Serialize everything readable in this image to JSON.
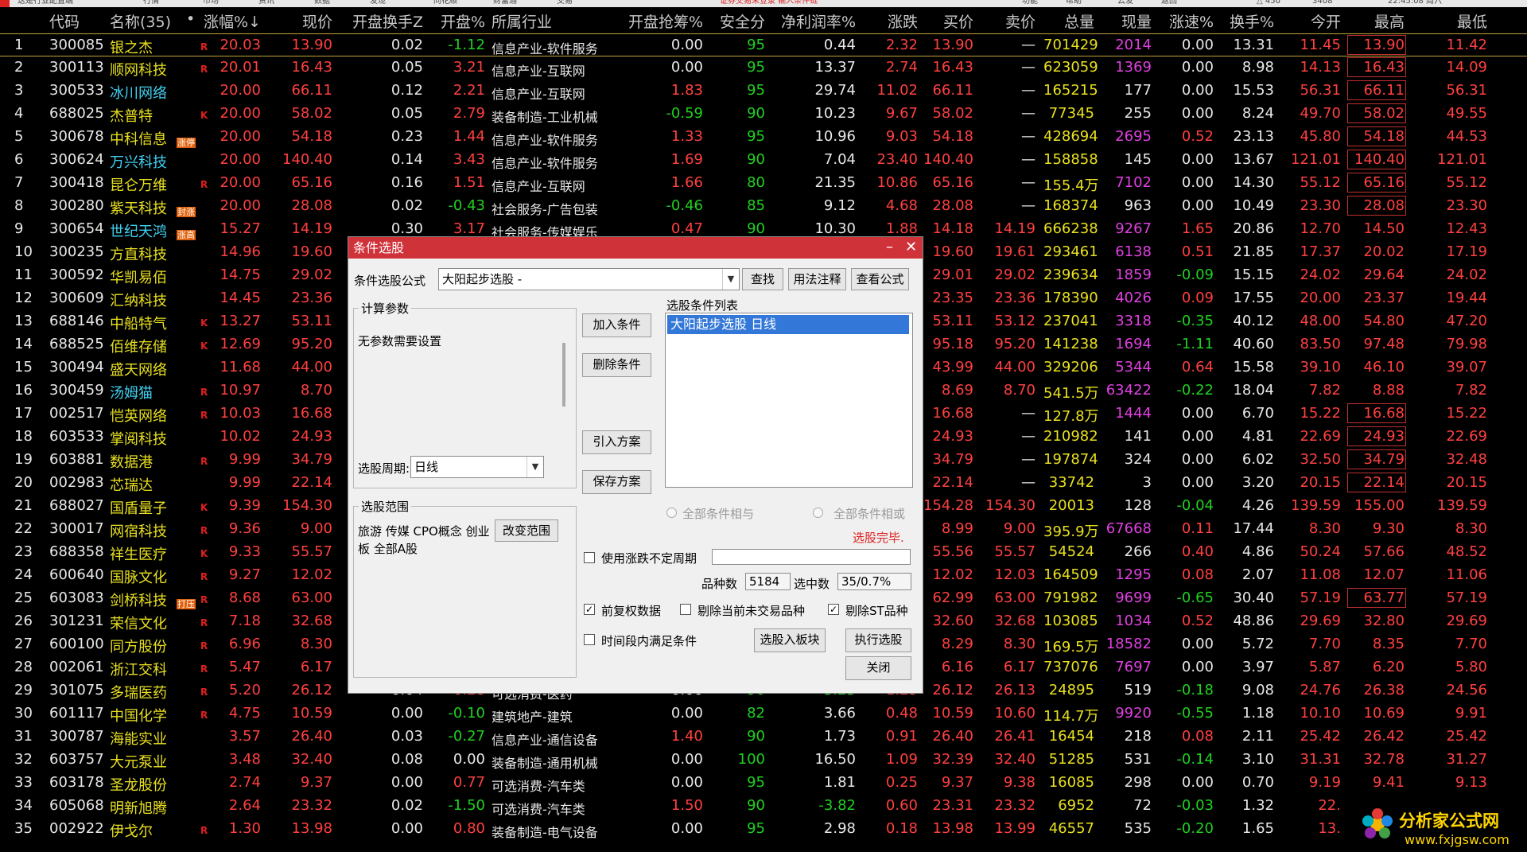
{
  "topbar": {
    "items": [
      "这是行业配置端",
      "行情",
      "市场",
      "资讯",
      "数据",
      "发现",
      "同花顺",
      "财富通",
      "交易",
      "证券交易未登录 输入条件链",
      "功能",
      "帮助",
      "云发",
      "返回",
      "△ 450",
      "3408",
      "22:45:08 周六"
    ]
  },
  "header": {
    "cols": [
      "代码",
      "名称(35)",
      "•",
      "涨幅%↓",
      "现价",
      "开盘换手Z",
      "开盘%",
      "所属行业",
      "开盘抢筹%",
      "安全分",
      "净利润率%",
      "涨跌",
      "买价",
      "卖价",
      "总量",
      "现量",
      "涨速%",
      "换手%",
      "今开",
      "最高",
      "最低"
    ]
  },
  "colors": {
    "red": "#ff4040",
    "green": "#20d020",
    "yellow": "#e8e020",
    "cyan": "#40d0f0",
    "white": "#e8e8e8",
    "magenta": "#e040e0",
    "dialog_title": "#d0323a",
    "selection": "#3378d8"
  },
  "rows": [
    {
      "no": "1",
      "code": "300085",
      "name": "银之杰",
      "tag": "",
      "flag": "R",
      "chg": "20.03",
      "price": "13.90",
      "oturn": "0.02",
      "opct": "-1.12",
      "industry": "信息产业-软件服务",
      "grab": "0.00",
      "safe": "95",
      "npm": "0.44",
      "diff": "2.32",
      "bid": "13.90",
      "ask": "—",
      "vol": "701429",
      "cur": "2014",
      "speed": "0.00",
      "turn": "13.31",
      "open": "11.45",
      "high": "13.90",
      "low": "11.42",
      "nameColor": "yellow"
    },
    {
      "no": "2",
      "code": "300113",
      "name": "顺网科技",
      "tag": "",
      "flag": "R",
      "chg": "20.01",
      "price": "16.43",
      "oturn": "0.05",
      "opct": "3.21",
      "industry": "信息产业-互联网",
      "grab": "0.00",
      "safe": "95",
      "npm": "13.37",
      "diff": "2.74",
      "bid": "16.43",
      "ask": "—",
      "vol": "623059",
      "cur": "1369",
      "speed": "0.00",
      "turn": "8.98",
      "open": "14.13",
      "high": "16.43",
      "low": "14.09",
      "nameColor": "yellow"
    },
    {
      "no": "3",
      "code": "300533",
      "name": "冰川网络",
      "tag": "",
      "flag": "",
      "chg": "20.00",
      "price": "66.11",
      "oturn": "0.12",
      "opct": "2.21",
      "industry": "信息产业-互联网",
      "grab": "1.83",
      "safe": "95",
      "npm": "29.74",
      "diff": "11.02",
      "bid": "66.11",
      "ask": "—",
      "vol": "165215",
      "cur": "177",
      "speed": "0.00",
      "turn": "15.53",
      "open": "56.31",
      "high": "66.11",
      "low": "56.31",
      "nameColor": "cyan"
    },
    {
      "no": "4",
      "code": "688025",
      "name": "杰普特",
      "tag": "",
      "flag": "K",
      "chg": "20.00",
      "price": "58.02",
      "oturn": "0.05",
      "opct": "2.79",
      "industry": "装备制造-工业机械",
      "grab": "-0.59",
      "safe": "90",
      "npm": "10.23",
      "diff": "9.67",
      "bid": "58.02",
      "ask": "—",
      "vol": "77345",
      "cur": "255",
      "speed": "0.00",
      "turn": "8.24",
      "open": "49.70",
      "high": "58.02",
      "low": "49.55",
      "nameColor": "yellow"
    },
    {
      "no": "5",
      "code": "300678",
      "name": "中科信息",
      "tag": "涨停",
      "flag": "",
      "chg": "20.00",
      "price": "54.18",
      "oturn": "0.23",
      "opct": "1.44",
      "industry": "信息产业-软件服务",
      "grab": "1.33",
      "safe": "95",
      "npm": "10.96",
      "diff": "9.03",
      "bid": "54.18",
      "ask": "—",
      "vol": "428694",
      "cur": "2695",
      "speed": "0.52",
      "turn": "23.13",
      "open": "45.80",
      "high": "54.18",
      "low": "44.53",
      "nameColor": "yellow"
    },
    {
      "no": "6",
      "code": "300624",
      "name": "万兴科技",
      "tag": "",
      "flag": "",
      "chg": "20.00",
      "price": "140.40",
      "oturn": "0.14",
      "opct": "3.43",
      "industry": "信息产业-软件服务",
      "grab": "1.69",
      "safe": "90",
      "npm": "7.04",
      "diff": "23.40",
      "bid": "140.40",
      "ask": "—",
      "vol": "158858",
      "cur": "145",
      "speed": "0.00",
      "turn": "13.67",
      "open": "121.01",
      "high": "140.40",
      "low": "121.01",
      "nameColor": "cyan"
    },
    {
      "no": "7",
      "code": "300418",
      "name": "昆仑万维",
      "tag": "",
      "flag": "R",
      "chg": "20.00",
      "price": "65.16",
      "oturn": "0.16",
      "opct": "1.51",
      "industry": "信息产业-互联网",
      "grab": "1.66",
      "safe": "80",
      "npm": "21.35",
      "diff": "10.86",
      "bid": "65.16",
      "ask": "—",
      "vol": "155.4万",
      "cur": "7102",
      "speed": "0.00",
      "turn": "14.30",
      "open": "55.12",
      "high": "65.16",
      "low": "55.12",
      "nameColor": "yellow"
    },
    {
      "no": "8",
      "code": "300280",
      "name": "紫天科技",
      "tag": "封涨",
      "flag": "",
      "chg": "20.00",
      "price": "28.08",
      "oturn": "0.02",
      "opct": "-0.43",
      "industry": "社会服务-广告包装",
      "grab": "-0.46",
      "safe": "85",
      "npm": "9.12",
      "diff": "4.68",
      "bid": "28.08",
      "ask": "—",
      "vol": "168374",
      "cur": "963",
      "speed": "0.00",
      "turn": "10.49",
      "open": "23.30",
      "high": "28.08",
      "low": "23.30",
      "nameColor": "yellow"
    },
    {
      "no": "9",
      "code": "300654",
      "name": "世纪天鸿",
      "tag": "涨高",
      "flag": "",
      "chg": "15.27",
      "price": "14.19",
      "oturn": "0.30",
      "opct": "3.17",
      "industry": "社会服务-传媒娱乐",
      "grab": "0.47",
      "safe": "90",
      "npm": "10.30",
      "diff": "1.88",
      "bid": "14.18",
      "ask": "14.19",
      "vol": "666238",
      "cur": "9267",
      "speed": "1.65",
      "turn": "20.86",
      "open": "12.70",
      "high": "14.50",
      "low": "12.43",
      "nameColor": "cyan"
    },
    {
      "no": "10",
      "code": "300235",
      "name": "方直科技",
      "tag": "",
      "flag": "",
      "chg": "14.96",
      "price": "19.60",
      "bid": "19.60",
      "ask": "19.61",
      "vol": "293461",
      "cur": "6138",
      "speed": "0.51",
      "turn": "21.85",
      "open": "17.37",
      "high": "20.02",
      "low": "17.19",
      "nameColor": "yellow"
    },
    {
      "no": "11",
      "code": "300592",
      "name": "华凯易佰",
      "tag": "",
      "flag": "",
      "chg": "14.75",
      "price": "29.02",
      "bid": "29.01",
      "ask": "29.02",
      "vol": "239634",
      "cur": "1859",
      "speed": "-0.09",
      "turn": "15.15",
      "open": "24.02",
      "high": "29.64",
      "low": "24.02",
      "nameColor": "yellow"
    },
    {
      "no": "12",
      "code": "300609",
      "name": "汇纳科技",
      "tag": "",
      "flag": "",
      "chg": "14.45",
      "price": "23.36",
      "bid": "23.35",
      "ask": "23.36",
      "vol": "178390",
      "cur": "4026",
      "speed": "0.09",
      "turn": "17.55",
      "open": "20.00",
      "high": "23.37",
      "low": "19.44",
      "nameColor": "yellow"
    },
    {
      "no": "13",
      "code": "688146",
      "name": "中船特气",
      "tag": "",
      "flag": "K",
      "chg": "13.27",
      "price": "53.11",
      "bid": "53.11",
      "ask": "53.12",
      "vol": "237041",
      "cur": "3318",
      "speed": "-0.35",
      "turn": "40.12",
      "open": "48.00",
      "high": "54.80",
      "low": "47.20",
      "nameColor": "yellow"
    },
    {
      "no": "14",
      "code": "688525",
      "name": "佰维存储",
      "tag": "",
      "flag": "K",
      "chg": "12.69",
      "price": "95.20",
      "bid": "95.18",
      "ask": "95.20",
      "vol": "141238",
      "cur": "1694",
      "speed": "-1.11",
      "turn": "40.60",
      "open": "83.50",
      "high": "97.48",
      "low": "79.98",
      "nameColor": "yellow"
    },
    {
      "no": "15",
      "code": "300494",
      "name": "盛天网络",
      "tag": "",
      "flag": "",
      "chg": "11.68",
      "price": "44.00",
      "bid": "43.99",
      "ask": "44.00",
      "vol": "329206",
      "cur": "5344",
      "speed": "0.64",
      "turn": "15.58",
      "open": "39.10",
      "high": "46.10",
      "low": "39.07",
      "nameColor": "yellow"
    },
    {
      "no": "16",
      "code": "300459",
      "name": "汤姆猫",
      "tag": "",
      "flag": "R",
      "chg": "10.97",
      "price": "8.70",
      "bid": "8.69",
      "ask": "8.70",
      "vol": "541.5万",
      "cur": "63422",
      "speed": "-0.22",
      "turn": "18.04",
      "open": "7.82",
      "high": "8.88",
      "low": "7.82",
      "nameColor": "cyan"
    },
    {
      "no": "17",
      "code": "002517",
      "name": "恺英网络",
      "tag": "",
      "flag": "R",
      "chg": "10.03",
      "price": "16.68",
      "bid": "16.68",
      "ask": "—",
      "vol": "127.8万",
      "cur": "1444",
      "speed": "0.00",
      "turn": "6.70",
      "open": "15.22",
      "high": "16.68",
      "low": "15.22",
      "nameColor": "yellow"
    },
    {
      "no": "18",
      "code": "603533",
      "name": "掌阅科技",
      "tag": "",
      "flag": "",
      "chg": "10.02",
      "price": "24.93",
      "bid": "24.93",
      "ask": "—",
      "vol": "210982",
      "cur": "141",
      "speed": "0.00",
      "turn": "4.81",
      "open": "22.69",
      "high": "24.93",
      "low": "22.69",
      "nameColor": "yellow"
    },
    {
      "no": "19",
      "code": "603881",
      "name": "数据港",
      "tag": "",
      "flag": "R",
      "chg": "9.99",
      "price": "34.79",
      "bid": "34.79",
      "ask": "—",
      "vol": "197874",
      "cur": "324",
      "speed": "0.00",
      "turn": "6.02",
      "open": "32.50",
      "high": "34.79",
      "low": "32.48",
      "nameColor": "yellow"
    },
    {
      "no": "20",
      "code": "002983",
      "name": "芯瑞达",
      "tag": "",
      "flag": "",
      "chg": "9.99",
      "price": "22.14",
      "bid": "22.14",
      "ask": "—",
      "vol": "33742",
      "cur": "3",
      "speed": "0.00",
      "turn": "3.20",
      "open": "20.15",
      "high": "22.14",
      "low": "20.15",
      "nameColor": "yellow"
    },
    {
      "no": "21",
      "code": "688027",
      "name": "国盾量子",
      "tag": "",
      "flag": "K",
      "chg": "9.39",
      "price": "154.30",
      "bid": "154.28",
      "ask": "154.30",
      "vol": "20013",
      "cur": "128",
      "speed": "-0.04",
      "turn": "4.26",
      "open": "139.59",
      "high": "155.00",
      "low": "139.59",
      "nameColor": "yellow"
    },
    {
      "no": "22",
      "code": "300017",
      "name": "网宿科技",
      "tag": "",
      "flag": "R",
      "chg": "9.36",
      "price": "9.00",
      "bid": "8.99",
      "ask": "9.00",
      "vol": "395.9万",
      "cur": "67668",
      "speed": "0.11",
      "turn": "17.44",
      "open": "8.30",
      "high": "9.30",
      "low": "8.30",
      "nameColor": "yellow"
    },
    {
      "no": "23",
      "code": "688358",
      "name": "祥生医疗",
      "tag": "",
      "flag": "K",
      "chg": "9.33",
      "price": "55.57",
      "bid": "55.56",
      "ask": "55.57",
      "vol": "54524",
      "cur": "266",
      "speed": "0.40",
      "turn": "4.86",
      "open": "50.24",
      "high": "57.66",
      "low": "48.52",
      "nameColor": "yellow"
    },
    {
      "no": "24",
      "code": "600640",
      "name": "国脉文化",
      "tag": "",
      "flag": "R",
      "chg": "9.27",
      "price": "12.02",
      "bid": "12.02",
      "ask": "12.03",
      "vol": "164509",
      "cur": "1295",
      "speed": "0.08",
      "turn": "2.07",
      "open": "11.08",
      "high": "12.07",
      "low": "11.06",
      "nameColor": "yellow"
    },
    {
      "no": "25",
      "code": "603083",
      "name": "剑桥科技",
      "tag": "打压",
      "flag": "R",
      "chg": "8.68",
      "price": "63.00",
      "bid": "62.99",
      "ask": "63.00",
      "vol": "791982",
      "cur": "9699",
      "speed": "-0.65",
      "turn": "30.40",
      "open": "57.19",
      "high": "63.77",
      "low": "57.19",
      "nameColor": "yellow"
    },
    {
      "no": "26",
      "code": "301231",
      "name": "荣信文化",
      "tag": "",
      "flag": "R",
      "chg": "7.18",
      "price": "32.68",
      "bid": "32.60",
      "ask": "32.68",
      "vol": "103085",
      "cur": "1034",
      "speed": "0.52",
      "turn": "48.86",
      "open": "29.69",
      "high": "32.80",
      "low": "29.69",
      "nameColor": "yellow"
    },
    {
      "no": "27",
      "code": "600100",
      "name": "同方股份",
      "tag": "",
      "flag": "R",
      "chg": "6.96",
      "price": "8.30",
      "bid": "8.29",
      "ask": "8.30",
      "vol": "169.5万",
      "cur": "18582",
      "speed": "0.00",
      "turn": "5.72",
      "open": "7.70",
      "high": "8.35",
      "low": "7.70",
      "nameColor": "yellow"
    },
    {
      "no": "28",
      "code": "002061",
      "name": "浙江交科",
      "tag": "",
      "flag": "R",
      "chg": "5.47",
      "price": "6.17",
      "bid": "6.16",
      "ask": "6.17",
      "vol": "737076",
      "cur": "7697",
      "speed": "0.00",
      "turn": "3.97",
      "open": "5.87",
      "high": "6.20",
      "low": "5.80",
      "nameColor": "yellow"
    },
    {
      "no": "29",
      "code": "301075",
      "name": "多瑞医药",
      "tag": "",
      "flag": "R",
      "chg": "5.20",
      "price": "26.12",
      "oturn": "0.04",
      "opct": "0.28",
      "industry": "可选消费-医药",
      "grab": "0.00",
      "safe": "90",
      "npm": "-3.23",
      "diff": "1.29",
      "bid": "26.12",
      "ask": "26.13",
      "vol": "24895",
      "cur": "519",
      "speed": "-0.18",
      "turn": "9.08",
      "open": "24.76",
      "high": "26.38",
      "low": "24.56",
      "nameColor": "yellow"
    },
    {
      "no": "30",
      "code": "601117",
      "name": "中国化学",
      "tag": "",
      "flag": "R",
      "chg": "4.75",
      "price": "10.59",
      "oturn": "0.00",
      "opct": "-0.10",
      "industry": "建筑地产-建筑",
      "grab": "0.00",
      "safe": "82",
      "npm": "3.66",
      "diff": "0.48",
      "bid": "10.59",
      "ask": "10.60",
      "vol": "114.7万",
      "cur": "9920",
      "speed": "-0.55",
      "turn": "1.18",
      "open": "10.10",
      "high": "10.69",
      "low": "9.91",
      "nameColor": "yellow"
    },
    {
      "no": "31",
      "code": "300787",
      "name": "海能实业",
      "tag": "",
      "flag": "",
      "chg": "3.57",
      "price": "26.40",
      "oturn": "0.03",
      "opct": "-0.27",
      "industry": "信息产业-通信设备",
      "grab": "1.40",
      "safe": "90",
      "npm": "1.73",
      "diff": "0.91",
      "bid": "26.40",
      "ask": "26.41",
      "vol": "16454",
      "cur": "218",
      "speed": "0.08",
      "turn": "2.11",
      "open": "25.42",
      "high": "26.42",
      "low": "25.42",
      "nameColor": "yellow"
    },
    {
      "no": "32",
      "code": "603757",
      "name": "大元泵业",
      "tag": "",
      "flag": "",
      "chg": "3.48",
      "price": "32.40",
      "oturn": "0.08",
      "opct": "0.00",
      "industry": "装备制造-通用机械",
      "grab": "0.00",
      "safe": "100",
      "npm": "16.50",
      "diff": "1.09",
      "bid": "32.39",
      "ask": "32.40",
      "vol": "51285",
      "cur": "531",
      "speed": "-0.14",
      "turn": "3.10",
      "open": "31.31",
      "high": "32.78",
      "low": "31.27",
      "nameColor": "yellow"
    },
    {
      "no": "33",
      "code": "603178",
      "name": "圣龙股份",
      "tag": "",
      "flag": "",
      "chg": "2.74",
      "price": "9.37",
      "oturn": "0.00",
      "opct": "0.77",
      "industry": "可选消费-汽车类",
      "grab": "0.00",
      "safe": "95",
      "npm": "1.81",
      "diff": "0.25",
      "bid": "9.37",
      "ask": "9.38",
      "vol": "16085",
      "cur": "298",
      "speed": "0.00",
      "turn": "0.70",
      "open": "9.19",
      "high": "9.41",
      "low": "9.13",
      "nameColor": "yellow"
    },
    {
      "no": "34",
      "code": "605068",
      "name": "明新旭腾",
      "tag": "",
      "flag": "",
      "chg": "2.64",
      "price": "23.32",
      "oturn": "0.02",
      "opct": "-1.50",
      "industry": "可选消费-汽车类",
      "grab": "1.50",
      "safe": "90",
      "npm": "-3.82",
      "diff": "0.60",
      "bid": "23.31",
      "ask": "23.32",
      "vol": "6952",
      "cur": "72",
      "speed": "-0.03",
      "turn": "1.32",
      "open": "22.",
      "high": "",
      "low": "",
      "nameColor": "yellow"
    },
    {
      "no": "35",
      "code": "002922",
      "name": "伊戈尔",
      "tag": "",
      "flag": "R",
      "chg": "1.30",
      "price": "13.98",
      "oturn": "0.00",
      "opct": "0.80",
      "industry": "装备制造-电气设备",
      "grab": "0.00",
      "safe": "95",
      "npm": "2.98",
      "diff": "0.18",
      "bid": "13.98",
      "ask": "13.99",
      "vol": "46557",
      "cur": "535",
      "speed": "-0.20",
      "turn": "1.65",
      "open": "13.",
      "high": "",
      "low": "",
      "nameColor": "yellow"
    }
  ],
  "dialog": {
    "title": "条件选股",
    "formula_label": "条件选股公式",
    "formula_value": "大阳起步选股  -",
    "btn_find": "查找",
    "btn_usage": "用法注释",
    "btn_view": "查看公式",
    "params_group": "计算参数",
    "params_text": "无参数需要设置",
    "period_label": "选股周期:",
    "period_value": "日线",
    "btn_add": "加入条件",
    "btn_delete": "删除条件",
    "btn_import": "引入方案",
    "btn_save": "保存方案",
    "list_title": "选股条件列表",
    "list_item": "大阳起步选股  日线",
    "radio_and": "全部条件相与",
    "radio_or": "全部条件相或",
    "status": "选股完毕.",
    "scope_group": "选股范围",
    "scope_text": "旅游 传媒 CPO概念 创业板 全部A股",
    "btn_change_scope": "改变范围",
    "chk_use_period": "使用涨跌不定周期",
    "count_label": "品种数",
    "count_value": "5184",
    "selected_label": "选中数",
    "selected_value": "35/0.7%",
    "chk_prefq": "前复权数据",
    "chk_exclude_inactive": "剔除当前未交易品种",
    "chk_exclude_st": "剔除ST品种",
    "chk_time": "时间段内满足条件",
    "btn_to_block": "选股入板块",
    "btn_execute": "执行选股",
    "btn_close": "关闭",
    "checked": {
      "prefq": "✓",
      "exclude_st": "✓"
    }
  },
  "logo": {
    "title": "分析家公式网",
    "url": "www.fxjgsw.com"
  }
}
